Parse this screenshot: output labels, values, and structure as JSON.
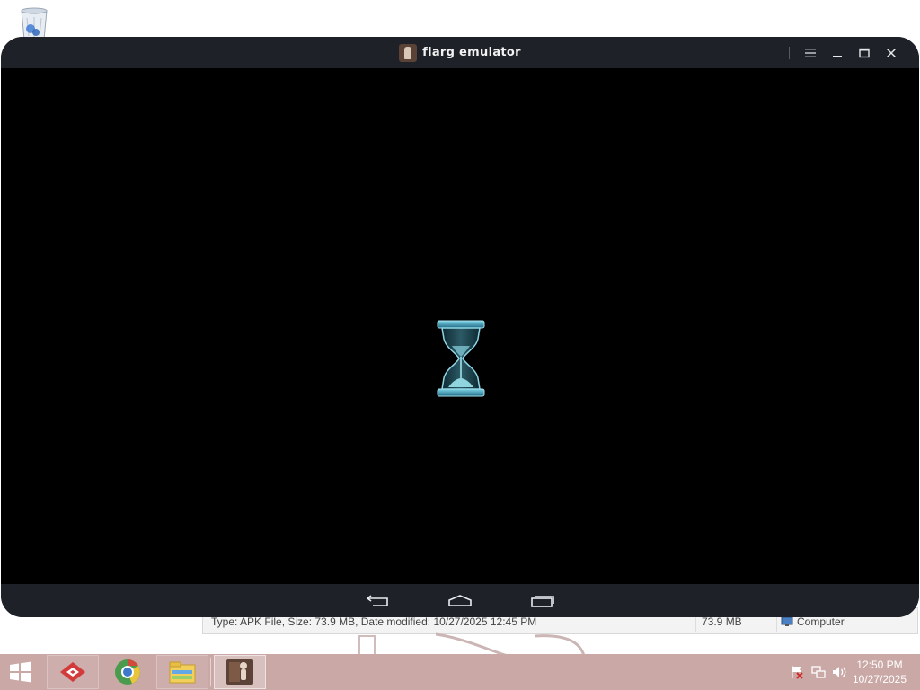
{
  "emulator": {
    "title": "flarg emulator",
    "controls": [
      "menu-icon",
      "minimize-icon",
      "maximize-icon",
      "close-icon"
    ],
    "screen_state": "loading",
    "loading_icon": "hourglass-icon",
    "nav_buttons": [
      "back-icon",
      "home-icon",
      "recents-icon"
    ]
  },
  "background_window": {
    "status_text": "Type: APK File, Size: 73.9 MB, Date modified: 10/27/2025 12:45 PM",
    "size_text": "73.9 MB",
    "location_text": "Computer"
  },
  "taskbar": {
    "start_icon": "windows-start-icon",
    "pinned": [
      "genymotion-icon",
      "chrome-icon",
      "file-explorer-icon"
    ],
    "active_app": "flarg-emulator-icon",
    "tray_icons": [
      "action-center-flag-icon",
      "network-icon",
      "volume-icon"
    ],
    "time": "12:50 PM",
    "date": "10/27/2025"
  },
  "desktop": {
    "icons": [
      "recycle-bin-icon"
    ]
  }
}
